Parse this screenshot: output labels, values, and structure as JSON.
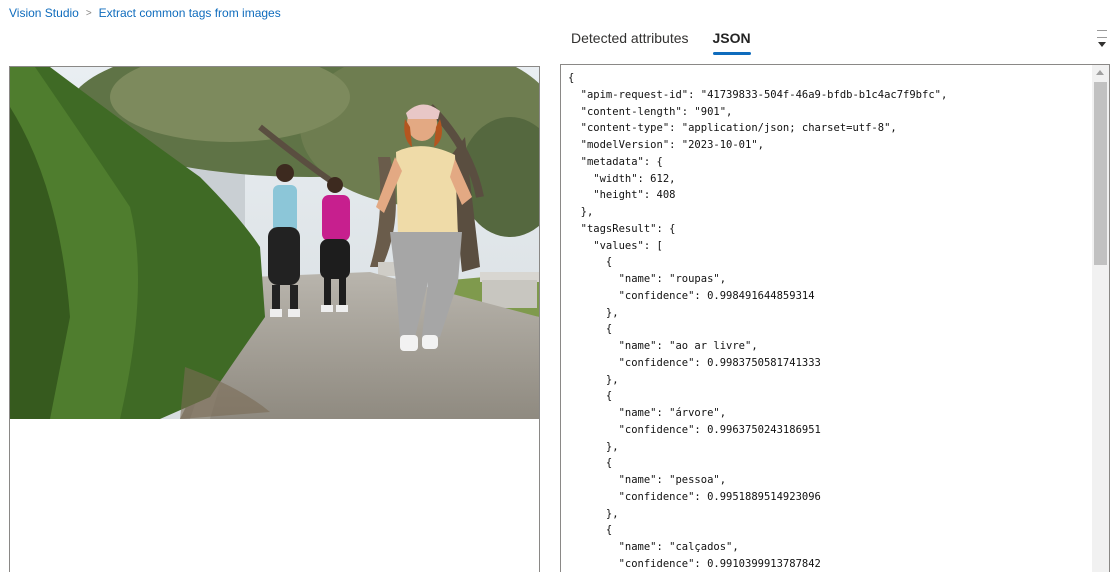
{
  "breadcrumb": {
    "items": [
      "Vision Studio",
      "Extract common tags from images"
    ],
    "separator": ">"
  },
  "tabs": [
    {
      "label": "Detected attributes",
      "active": false
    },
    {
      "label": "JSON",
      "active": true
    }
  ],
  "image": {
    "alt": "Three women walking on a park path lined with trees and hedges"
  },
  "json_lines": [
    "{",
    "  \"apim-request-id\": \"41739833-504f-46a9-bfdb-b1c4ac7f9bfc\",",
    "  \"content-length\": \"901\",",
    "  \"content-type\": \"application/json; charset=utf-8\",",
    "  \"modelVersion\": \"2023-10-01\",",
    "  \"metadata\": {",
    "    \"width\": 612,",
    "    \"height\": 408",
    "  },",
    "  \"tagsResult\": {",
    "    \"values\": [",
    "      {",
    "        \"name\": \"roupas\",",
    "        \"confidence\": 0.998491644859314",
    "      },",
    "      {",
    "        \"name\": \"ao ar livre\",",
    "        \"confidence\": 0.9983750581741333",
    "      },",
    "      {",
    "        \"name\": \"árvore\",",
    "        \"confidence\": 0.9963750243186951",
    "      },",
    "      {",
    "        \"name\": \"pessoa\",",
    "        \"confidence\": 0.9951889514923096",
    "      },",
    "      {",
    "        \"name\": \"calçados\",",
    "        \"confidence\": 0.9910399913787842"
  ],
  "colors": {
    "accent": "#0f6cbd",
    "border": "#8a8886",
    "scrollbar_thumb": "#c1c1c1"
  }
}
